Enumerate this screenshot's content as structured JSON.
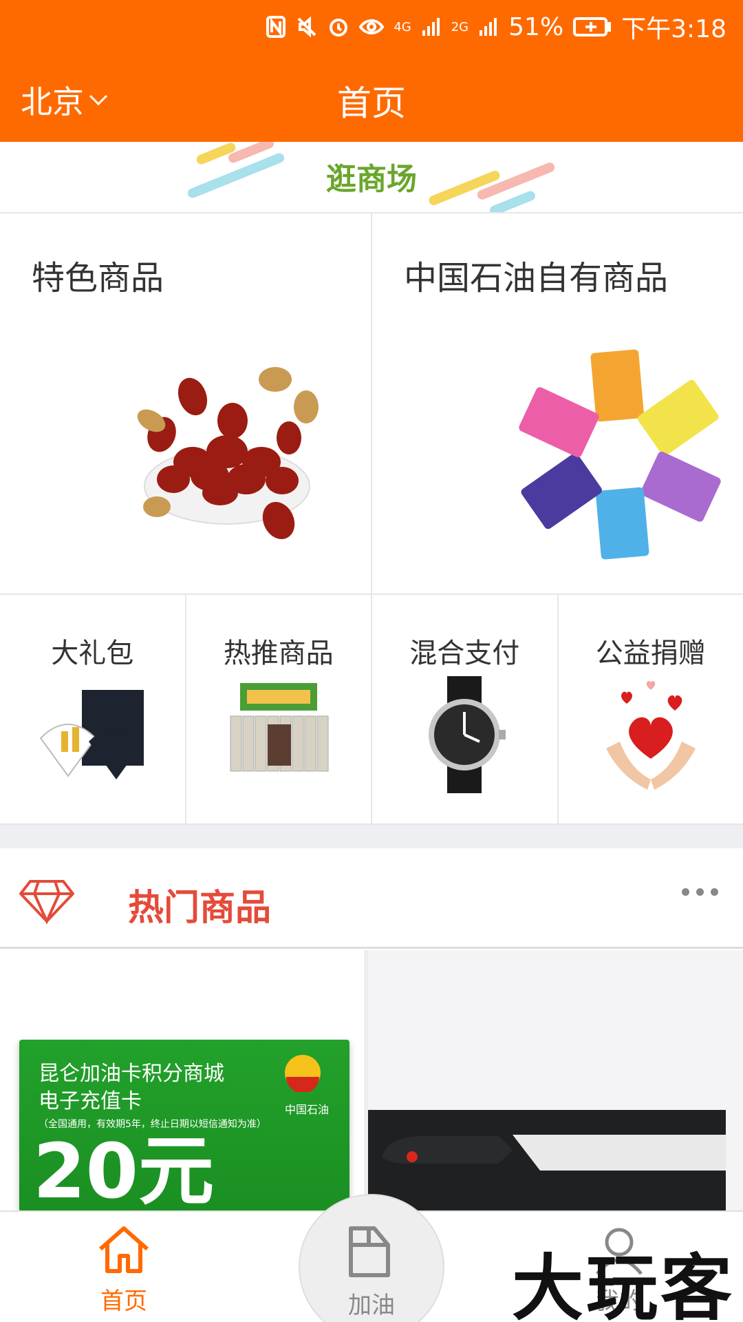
{
  "status_bar": {
    "signal_4g": "4G",
    "signal_2g": "2G",
    "battery": "51%",
    "time": "下午3:18"
  },
  "header": {
    "city": "北京",
    "title": "首页"
  },
  "mall": {
    "title": "逛商场"
  },
  "features": [
    {
      "title": "特色商品",
      "image": "red-dates"
    },
    {
      "title": "中国石油自有商品",
      "image": "pony-cards"
    }
  ],
  "categories": [
    {
      "label": "大礼包",
      "image": "gift-box"
    },
    {
      "label": "热推商品",
      "image": "grain-pack"
    },
    {
      "label": "混合支付",
      "image": "watch"
    },
    {
      "label": "公益捐赠",
      "image": "hearts-hands"
    }
  ],
  "hot": {
    "title": "热门商品"
  },
  "products": [
    {
      "line1": "昆仑加油卡积分商城",
      "line2": "电子充值卡",
      "line3": "（全国通用，有效期5年，终止日期以短信通知为准）",
      "amount": "20元",
      "brand": "中国石油"
    },
    {
      "image": "knife"
    }
  ],
  "bottom_nav": [
    {
      "label": "首页",
      "icon": "home-icon",
      "active": true
    },
    {
      "label": "加油",
      "icon": "fuel-icon",
      "active": false
    },
    {
      "label": "我的",
      "icon": "user-icon",
      "active": false
    }
  ],
  "watermark": "大玩客",
  "colors": {
    "header": "#ff6a00",
    "mall_title": "#6aa62c",
    "hot_title": "#e44b3a",
    "nav_active": "#ff6a00"
  }
}
